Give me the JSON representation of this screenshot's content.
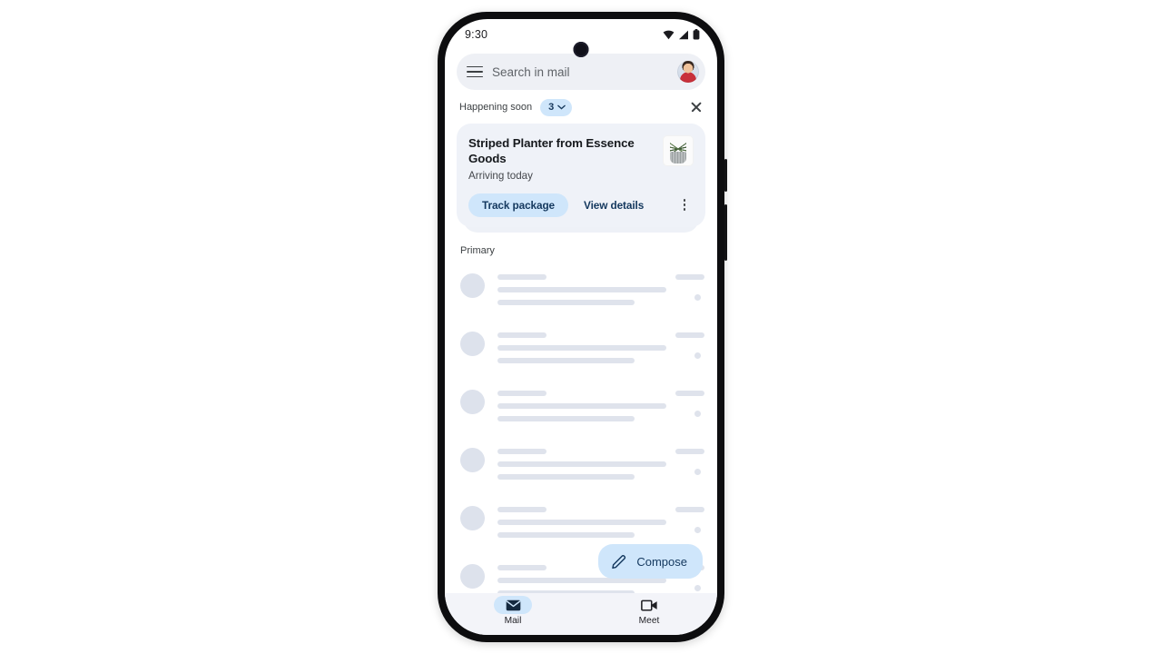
{
  "status_bar": {
    "time": "9:30",
    "icons": [
      "wifi-icon",
      "cellular-signal-icon",
      "battery-icon"
    ]
  },
  "search": {
    "menu_icon": "hamburger-menu-icon",
    "placeholder": "Search in mail",
    "avatar_label": "account-avatar"
  },
  "happening_soon": {
    "label": "Happening soon",
    "count": "3",
    "chevron_icon": "chevron-down-icon",
    "close_icon": "close-icon",
    "chip_color": "#cfe6fb"
  },
  "package_card": {
    "title": "Striped Planter from Essence Goods",
    "subtitle": "Arriving today",
    "thumbnail": "striped-planter-plant-image",
    "primary_button": "Track package",
    "secondary_button": "View details",
    "overflow_icon": "more-vertical-icon",
    "background": "#eff2f8",
    "accent": "#cfe6fb"
  },
  "inbox": {
    "section_label": "Primary",
    "skeleton_rows": 6
  },
  "compose": {
    "label": "Compose",
    "icon": "pencil-edit-icon",
    "background": "#cfe6fb",
    "text_color": "#14385e"
  },
  "bottom_nav": {
    "items": [
      {
        "label": "Mail",
        "icon": "envelope-icon",
        "active": true
      },
      {
        "label": "Meet",
        "icon": "video-camera-icon",
        "active": false
      }
    ]
  }
}
